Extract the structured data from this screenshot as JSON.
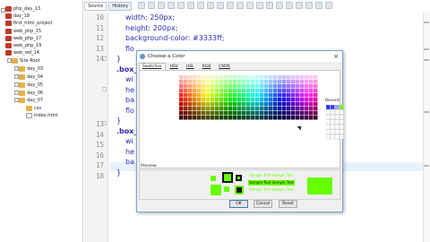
{
  "tree": {
    "items": [
      {
        "label": "php_day_13",
        "kind": "proj"
      },
      {
        "label": "day_18",
        "kind": "proj"
      },
      {
        "label": "first_html_project",
        "kind": "proj"
      },
      {
        "label": "web_php_15",
        "kind": "proj"
      },
      {
        "label": "web_php_17",
        "kind": "proj"
      },
      {
        "label": "web_php_19",
        "kind": "proj"
      },
      {
        "label": "web_wd_14",
        "kind": "proj"
      },
      {
        "label": "Site Root",
        "kind": "fold"
      },
      {
        "label": "day_03",
        "kind": "fold"
      },
      {
        "label": "day_04",
        "kind": "fold"
      },
      {
        "label": "day_05",
        "kind": "fold"
      },
      {
        "label": "day_06",
        "kind": "fold"
      },
      {
        "label": "day_07",
        "kind": "fold"
      },
      {
        "label": "css",
        "kind": "fold"
      },
      {
        "label": "index.html",
        "kind": "file"
      }
    ]
  },
  "editor": {
    "tabs": [
      {
        "label": "Source"
      },
      {
        "label": "History"
      }
    ],
    "lines": [
      {
        "n": "10",
        "text": "width: 250px;",
        "type": "prop"
      },
      {
        "n": "11",
        "text": "height: 200px;",
        "type": "prop"
      },
      {
        "n": "12",
        "text": "background-color: #3333ff;",
        "type": "prop"
      },
      {
        "n": "13",
        "text": "flo",
        "type": "prop"
      },
      {
        "n": "14",
        "text": "}",
        "type": "brace"
      },
      {
        "n": "",
        "text": ".box_",
        "type": "sel"
      },
      {
        "n": "",
        "text": "wi",
        "type": "prop"
      },
      {
        "n": "",
        "text": "he",
        "type": "prop"
      },
      {
        "n": "",
        "text": "ba",
        "type": "prop"
      },
      {
        "n": "",
        "text": "flo",
        "type": "prop"
      },
      {
        "n": "",
        "text": "}",
        "type": "brace"
      },
      {
        "n": "",
        "text": ".box_",
        "type": "sel"
      },
      {
        "n": "",
        "text": "wi",
        "type": "prop"
      },
      {
        "n": "",
        "text": "he",
        "type": "prop"
      },
      {
        "n": "",
        "text": "ba",
        "type": "prop"
      },
      {
        "n": "",
        "text": "}",
        "type": "brace"
      }
    ],
    "right_line_numbers": [
      "13",
      "14",
      "15",
      "16",
      "17",
      "18"
    ]
  },
  "dialog": {
    "title": "Choose a Color",
    "close": "×",
    "tabs": [
      {
        "label": "Swatches",
        "active": true
      },
      {
        "label": "HSV",
        "active": false
      },
      {
        "label": "HSL",
        "active": false
      },
      {
        "label": "RGB",
        "active": false
      },
      {
        "label": "CMYK",
        "active": false
      }
    ],
    "recent_label": "Recent:",
    "preview_label": "Preview",
    "sample_text": "Sample Text  Sample Text",
    "buttons": {
      "ok": "OK",
      "cancel": "Cancel",
      "reset": "Reset"
    },
    "colors": {
      "accent": "#66ff00",
      "dialog_bg": "#f0f0f0",
      "border": "#7aa6d6"
    }
  }
}
